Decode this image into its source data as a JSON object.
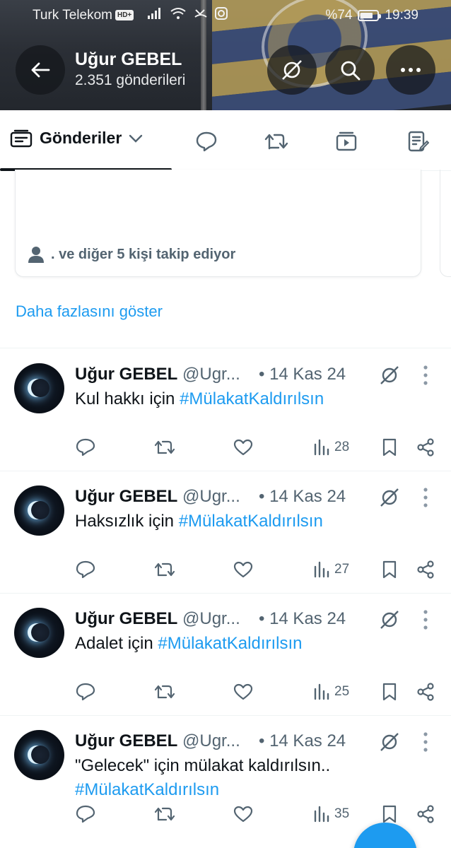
{
  "status_bar": {
    "carrier": "Turk Telekom",
    "hd_badge": "HD+",
    "battery": "%74",
    "battery_level": 0.74,
    "time": "19:39"
  },
  "profile": {
    "name": "Uğur GEBEL",
    "post_count": "2.351 gönderileri"
  },
  "header_icons": [
    "back-arrow-icon",
    "grok-icon",
    "search-icon",
    "more-horizontal-icon"
  ],
  "tabs": {
    "active_label": "Gönderiler",
    "icons": [
      "reply-bubble-icon",
      "retweet-icon",
      "media-play-icon",
      "article-icon"
    ]
  },
  "suggestion_card": {
    "follow_text": ". ve diğer 5 kişi takip ediyor"
  },
  "show_more": "Daha fazlasını göster",
  "tweets": [
    {
      "name": "Uğur GEBEL",
      "handle": "@Ugr...",
      "date": "• 14 Kas 24",
      "text": "Kul hakkı için ",
      "hashtag": "#MülakatKaldırılsın",
      "views": "28"
    },
    {
      "name": "Uğur GEBEL",
      "handle": "@Ugr...",
      "date": "• 14 Kas 24",
      "text": "Haksızlık için ",
      "hashtag": "#MülakatKaldırılsın",
      "views": "27"
    },
    {
      "name": "Uğur GEBEL",
      "handle": "@Ugr...",
      "date": "• 14 Kas 24",
      "text": "Adalet için ",
      "hashtag": "#MülakatKaldırılsın",
      "views": "25"
    },
    {
      "name": "Uğur GEBEL",
      "handle": "@Ugr...",
      "date": "• 14 Kas 24",
      "text": "\"Gelecek\" için mülakat kaldırılsın..",
      "hashtag": "#MülakatKaldırılsın",
      "views": "35"
    }
  ],
  "colors": {
    "accent": "#1d9bf0",
    "text_primary": "#0f1419",
    "text_secondary": "#536471"
  }
}
